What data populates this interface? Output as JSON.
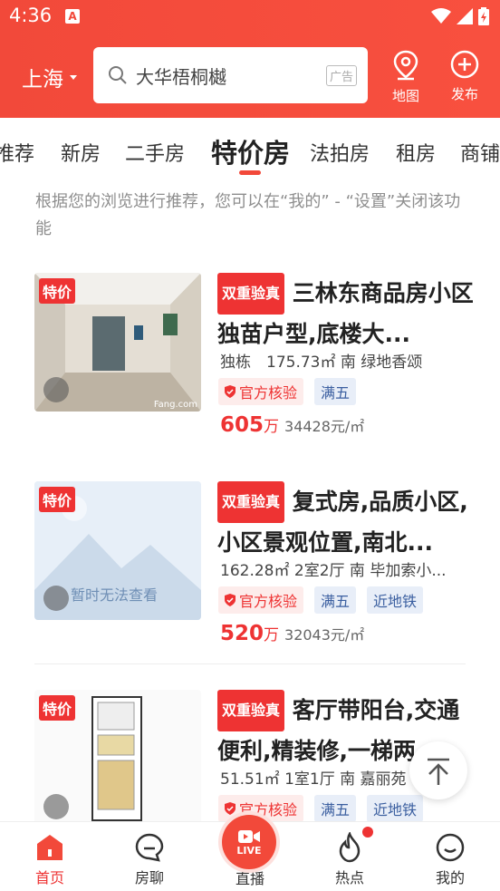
{
  "status": {
    "time": "4:36",
    "notif": "A"
  },
  "header": {
    "city": "上海",
    "search_text": "大华梧桐樾",
    "ad_label": "广告",
    "map_label": "地图",
    "publish_label": "发布"
  },
  "tabs": [
    {
      "label": "推荐"
    },
    {
      "label": "新房"
    },
    {
      "label": "二手房"
    },
    {
      "label": "特价房"
    },
    {
      "label": "法拍房"
    },
    {
      "label": "租房"
    },
    {
      "label": "商铺"
    }
  ],
  "hint": "根据您的浏览进行推荐，您可以在“我的” - “设置”关闭该功能",
  "listings": [
    {
      "badge": "特价",
      "tag": "双重验真",
      "title": "三林东商品房小区独苗户型,底楼大...",
      "specs": "独栋　175.73㎡ 南 绿地香颂",
      "tags": [
        "官方核验",
        "满五"
      ],
      "price": "605",
      "price_unit": "万",
      "unit_price": "34428元/㎡",
      "watermark": "Fang.com"
    },
    {
      "badge": "特价",
      "tag": "双重验真",
      "title": "复式房,品质小区,小区景观位置,南北...",
      "specs": "162.28㎡ 2室2厅 南 毕加索小...",
      "tags": [
        "官方核验",
        "满五",
        "近地铁"
      ],
      "price": "520",
      "price_unit": "万",
      "unit_price": "32043元/㎡",
      "placeholder_text": "暂时无法查看"
    },
    {
      "badge": "特价",
      "tag": "双重验真",
      "title": "客厅带阳台,交通便利,精装修,一梯两...",
      "specs": "51.51㎡ 1室1厅 南 嘉丽苑",
      "tags": [
        "官方核验",
        "满五",
        "近地铁"
      ]
    }
  ],
  "bottom_nav": [
    {
      "label": "首页"
    },
    {
      "label": "房聊"
    },
    {
      "label": "直播",
      "live_text": "LIVE"
    },
    {
      "label": "热点"
    },
    {
      "label": "我的"
    }
  ],
  "colors": {
    "brand_red": "#f2493a",
    "tag_blue": "#3b5fa0"
  }
}
